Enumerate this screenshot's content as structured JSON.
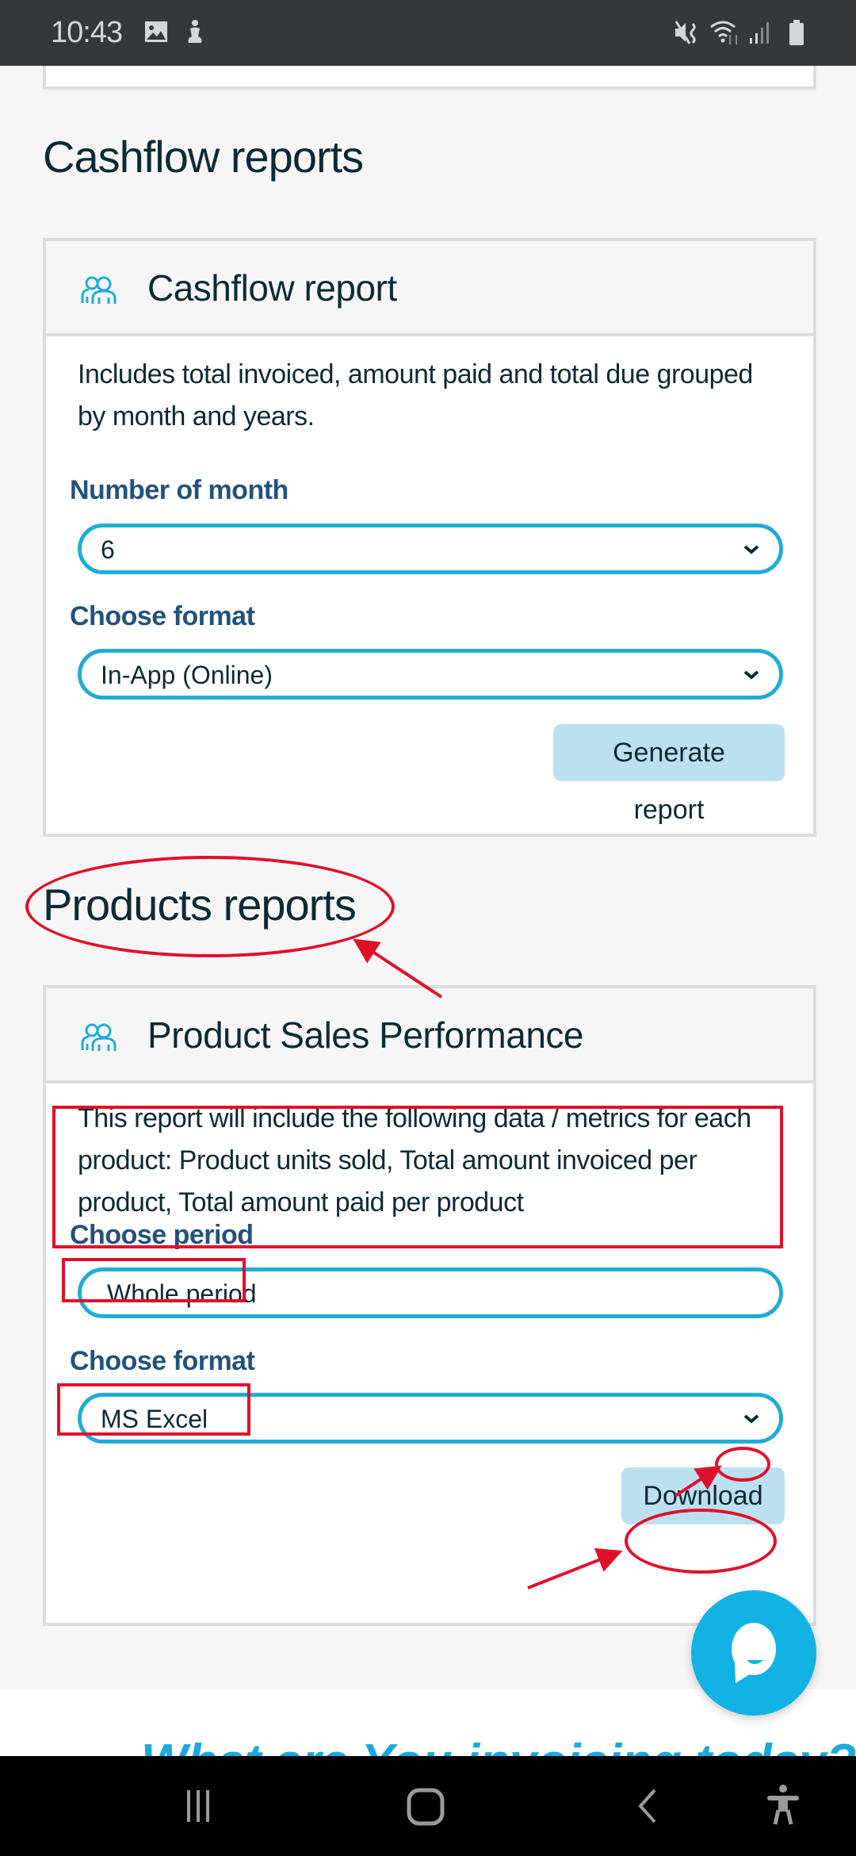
{
  "status_bar": {
    "time": "10:43",
    "left_icons": [
      "image-icon",
      "accessibility-service-icon"
    ],
    "right_icons": [
      "mute-vibrate-icon",
      "wifi-icon",
      "signal-icon",
      "battery-icon"
    ]
  },
  "cashflow_section": {
    "title": "Cashflow reports",
    "card": {
      "icon": "people-icon",
      "title": "Cashflow report",
      "description_lines": [
        "Includes total invoiced, amount paid and total due grouped",
        "by month and years."
      ],
      "fields": [
        {
          "label": "Number of month",
          "value": "6",
          "has_chevron": true
        },
        {
          "label": "Choose format",
          "value": "In-App (Online)",
          "has_chevron": true
        }
      ],
      "button_label": "Generate report"
    }
  },
  "products_section": {
    "title": "Products reports",
    "card": {
      "icon": "people-icon",
      "title": "Product Sales Performance",
      "description_lines": [
        "This report will include the following data / metrics for each",
        "product: Product units sold, Total amount invoiced per",
        "product, Total amount paid per product"
      ],
      "fields": [
        {
          "label": "Choose period",
          "value": "Whole period",
          "has_chevron": false
        },
        {
          "label": "Choose format",
          "value": "MS Excel",
          "has_chevron": true
        }
      ],
      "button_label": "Download"
    }
  },
  "chat_button": {
    "icon": "chat-bubble-icon",
    "color": "#12b2e4"
  },
  "footer": {
    "tagline": "What are You invoicing today?"
  },
  "nav_bar": {
    "buttons": [
      "recent-apps-icon",
      "home-icon",
      "back-icon",
      "accessibility-icon"
    ]
  },
  "colors": {
    "accent": "#21acd6",
    "label": "#24527a",
    "button_bg": "#bde0f1",
    "annotation": "#e0102b",
    "text": "#0e2a35"
  }
}
